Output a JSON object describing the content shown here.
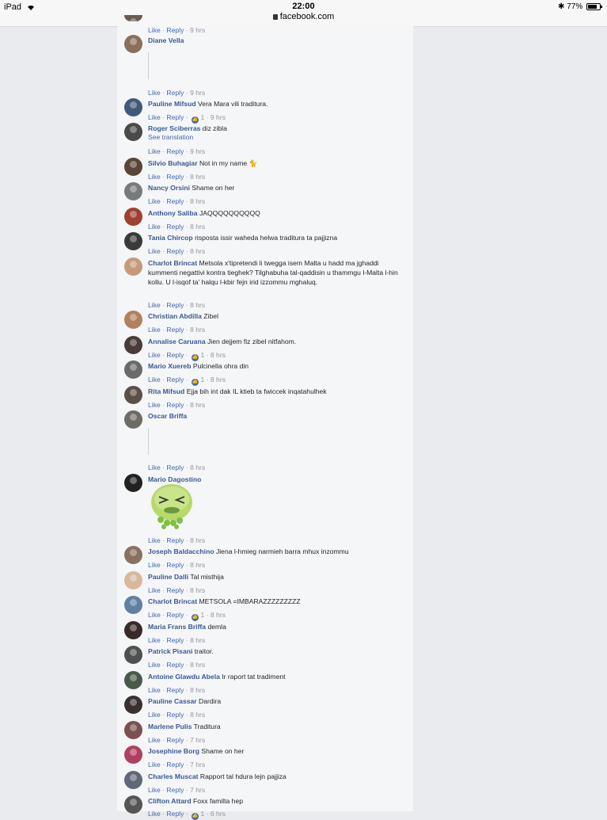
{
  "status_bar": {
    "device": "iPad",
    "time": "22:00",
    "url": "facebook.com",
    "battery": "77%"
  },
  "labels": {
    "like": "Like",
    "reply": "Reply",
    "see_translation": "See translation",
    "dot": "·"
  },
  "comments": [
    {
      "name": "",
      "text": "",
      "time": "9 hrs",
      "reactions": ""
    },
    {
      "name": "Diane Vella",
      "text": "",
      "time": "9 hrs",
      "reactions": ""
    },
    {
      "name": "Pauline Mifsud",
      "text": "Vera Mara vili traditura.",
      "time": "9 hrs",
      "reactions": "1"
    },
    {
      "name": "Roger Sciberras",
      "text": "diz zibla",
      "time": "9 hrs",
      "reactions": ""
    },
    {
      "name": "Silvio Buhagiar",
      "text": "Not in my name 🐈",
      "time": "8 hrs",
      "reactions": ""
    },
    {
      "name": "Nancy Orsini",
      "text": "Shame on her",
      "time": "8 hrs",
      "reactions": ""
    },
    {
      "name": "Anthony Saliba",
      "text": "JAQQQQQQQQQQ",
      "time": "8 hrs",
      "reactions": ""
    },
    {
      "name": "Tania Chircop",
      "text": "risposta issir waheda helwa traditura ta pajjizna",
      "time": "8 hrs",
      "reactions": ""
    },
    {
      "name": "Charlot Brincat",
      "text": "Metsola x'tipretendi li twegga isem Malta u hadd ma jghaddi kummenti negattivi kontra tieghek? Tilghabuha tal-qaddisin u thammgu l-Malta l-hin kollu. U l-isqof ta' halqu l-kbir fejn irid izzommu mghaluq.",
      "time": "8 hrs",
      "reactions": ""
    },
    {
      "name": "Christian Abdilla",
      "text": "Zibel",
      "time": "8 hrs",
      "reactions": ""
    },
    {
      "name": "Annalise Caruana",
      "text": "Jien dejjem fiz zibel nitfahom.",
      "time": "8 hrs",
      "reactions": "1"
    },
    {
      "name": "Mario Xuereb",
      "text": "Pulcinella ohra din",
      "time": "8 hrs",
      "reactions": "1"
    },
    {
      "name": "Rita Mifsud",
      "text": "Ejja bih int dak IL ktieb ta fwiccek inqatahulhek",
      "time": "8 hrs",
      "reactions": ""
    },
    {
      "name": "Oscar Briffa",
      "text": "",
      "time": "8 hrs",
      "reactions": ""
    },
    {
      "name": "Mario Dagostino",
      "text": "",
      "time": "8 hrs",
      "reactions": ""
    },
    {
      "name": "Joseph Baldacchino",
      "text": "Jiena l-hmieg narmieh barra mhux inzommu",
      "time": "8 hrs",
      "reactions": ""
    },
    {
      "name": "Pauline Dalli",
      "text": "Tal misthija",
      "time": "8 hrs",
      "reactions": ""
    },
    {
      "name": "Charlot Brincat",
      "text": "METSOLA =IMBARAZZZZZZZZZ",
      "time": "8 hrs",
      "reactions": "1"
    },
    {
      "name": "Maria Frans Briffa",
      "text": "demla",
      "time": "8 hrs",
      "reactions": ""
    },
    {
      "name": "Patrick Pisani",
      "text": "traitor.",
      "time": "8 hrs",
      "reactions": ""
    },
    {
      "name": "Antoine Glawdu Abela",
      "text": "Ir raport tat tradiment",
      "time": "8 hrs",
      "reactions": ""
    },
    {
      "name": "Pauline Cassar",
      "text": "Dardira",
      "time": "8 hrs",
      "reactions": ""
    },
    {
      "name": "Marlene Pulis",
      "text": "Traditura",
      "time": "7 hrs",
      "reactions": ""
    },
    {
      "name": "Josephine Borg",
      "text": "Shame on her",
      "time": "7 hrs",
      "reactions": ""
    },
    {
      "name": "Charles Muscat",
      "text": "Rapport tal hdura lejn pajjiza",
      "time": "7 hrs",
      "reactions": ""
    },
    {
      "name": "Clifton Attard",
      "text": "Foxx familta hep",
      "time": "6 hrs",
      "reactions": "1"
    }
  ],
  "colors": {
    "link": "#385898",
    "action": "#4267b2",
    "meta": "#90949c",
    "text": "#1d2129",
    "background": "#e9ebee",
    "panel": "#f5f6f7"
  }
}
